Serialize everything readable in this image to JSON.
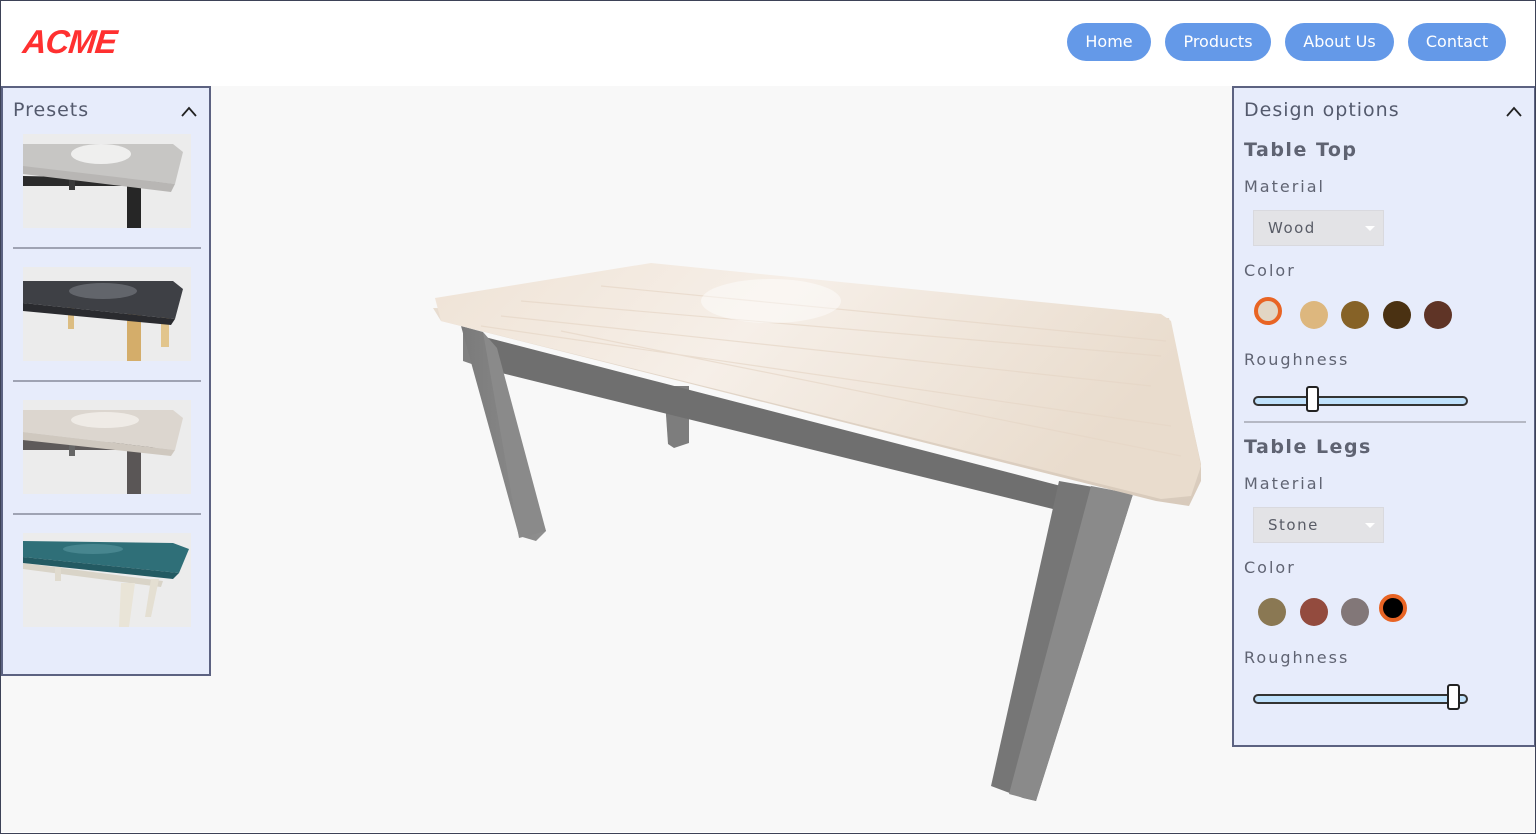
{
  "header": {
    "logo": "ACME",
    "nav": [
      "Home",
      "Products",
      "About Us",
      "Contact"
    ]
  },
  "presets": {
    "title": "Presets",
    "items": [
      {
        "name": "marble-top-black-legs",
        "top_color": "#c9c7c5",
        "leg_color": "#2a2a2a"
      },
      {
        "name": "dark-top-wood-legs",
        "top_color": "#3e4045",
        "leg_color": "#e2c58c"
      },
      {
        "name": "light-top-gray-legs",
        "top_color": "#dcd6cf",
        "leg_color": "#5a5656"
      },
      {
        "name": "teal-top-cream-legs",
        "top_color": "#2f6f78",
        "leg_color": "#e9e4d7"
      }
    ]
  },
  "design": {
    "title": "Design options",
    "table_top": {
      "title": "Table Top",
      "material_label": "Material",
      "material": "Wood",
      "color_label": "Color",
      "colors": [
        "#e2d6c4",
        "#ddb77e",
        "#866227",
        "#4a3112",
        "#5f3426"
      ],
      "selected_color": 0,
      "roughness_label": "Roughness",
      "roughness": 0.27
    },
    "table_legs": {
      "title": "Table Legs",
      "material_label": "Material",
      "material": "Stone",
      "color_label": "Color",
      "colors": [
        "#8a7853",
        "#934b3e",
        "#827778",
        "#000000"
      ],
      "selected_color": 3,
      "roughness_label": "Roughness",
      "roughness": 0.98
    }
  },
  "colors": {
    "accent": "#6499e8",
    "logo": "#ff3030",
    "panel_bg": "#e7ecfb",
    "selection_ring": "#e86424"
  }
}
